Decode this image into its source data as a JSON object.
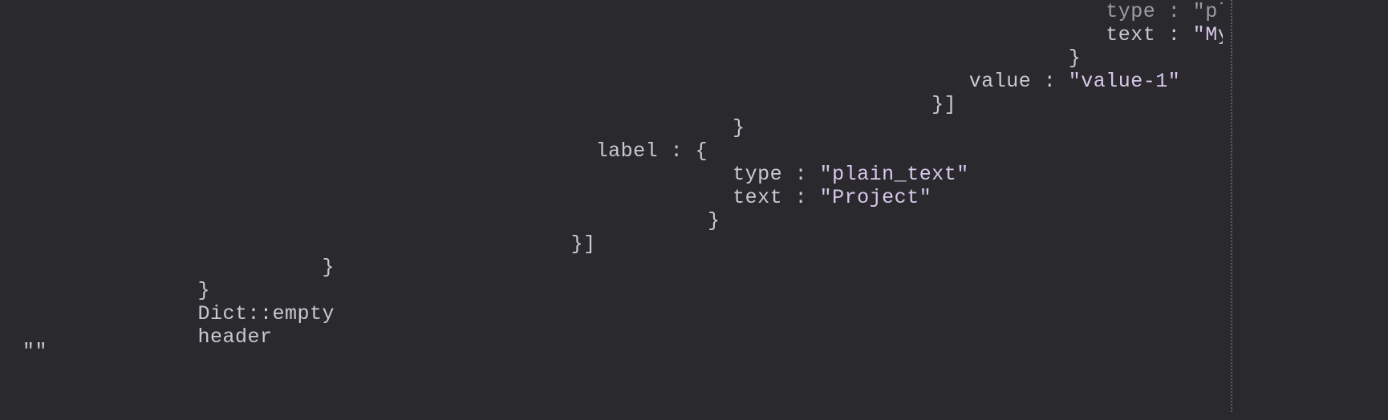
{
  "lines": {
    "l0": "                                                                                        type : \"plain_text\"",
    "l1_pre": "                                                                                        text : ",
    "l1_str": "\"My New Project\"",
    "l2": "                                                                                     }",
    "l3_pre": "                                                                             value : ",
    "l3_str": "\"value-1\"",
    "l4": "                                                                          }]",
    "l5": "                                                          }",
    "l6": "                                               label : {",
    "l7_pre": "                                                          type : ",
    "l7_str": "\"plain_text\"",
    "l8_pre": "                                                          text : ",
    "l8_str": "\"Project\"",
    "l9": "                                                        }",
    "l10": "                                             }]",
    "l11": "                         }",
    "l12": "               }",
    "l13": "               Dict::empty",
    "l14": "               header",
    "tail": "\"\""
  }
}
